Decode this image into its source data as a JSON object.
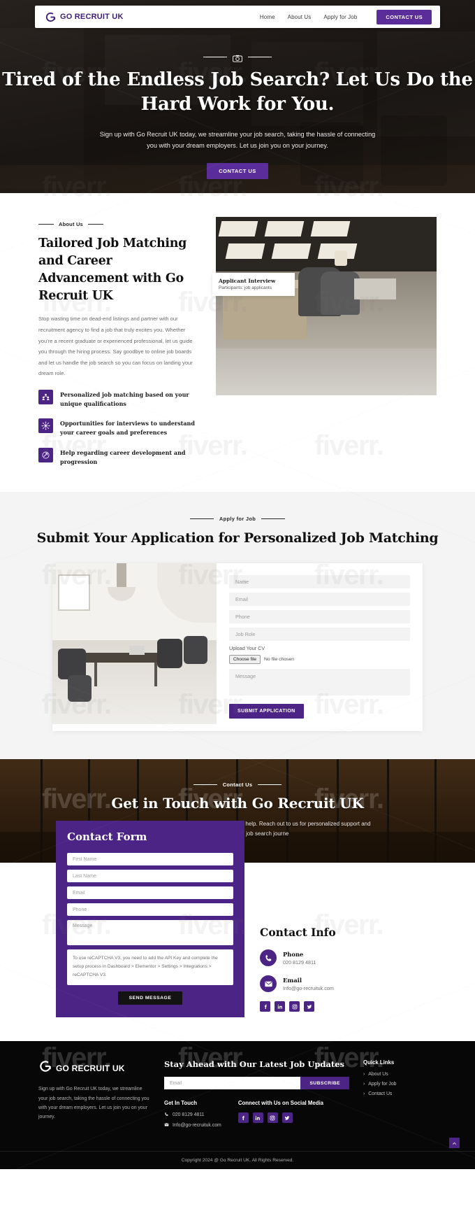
{
  "brand": {
    "name": "GO RECRUIT UK",
    "logo_icon": "g-circle-logo-icon"
  },
  "nav": {
    "links": [
      {
        "label": "Home"
      },
      {
        "label": "About Us"
      },
      {
        "label": "Apply for Job"
      }
    ],
    "cta": "CONTACT US"
  },
  "hero": {
    "eyebrow_icon": "camera-icon",
    "title": "Tired of the Endless Job Search? Let Us Do the Hard Work for You.",
    "subtitle": "Sign up with Go Recruit UK today, we streamline your job search, taking the hassle of connecting you with your dream employers. Let us join you on your journey.",
    "cta": "CONTACT US"
  },
  "about": {
    "eyebrow": "About Us",
    "heading": "Tailored Job Matching and Career Advancement with Go Recruit UK",
    "body": "Stop wasting time on dead-end listings and partner with our recruitment agency to find a job that truly excites you. Whether you're a recent graduate or experienced professional, let us guide you through the hiring process. Say goodbye to online job boards and let us handle the job search so you can focus on landing your dream role.",
    "features": [
      {
        "icon": "people-group-icon",
        "text": "Personalized job matching based on your unique qualifications"
      },
      {
        "icon": "network-nodes-icon",
        "text": "Opportunities for interviews to understand your career goals and preferences"
      },
      {
        "icon": "growth-arrow-icon",
        "text": "Help regarding career development and progression"
      }
    ],
    "photo_card": {
      "title": "Applicant Interview",
      "subtitle": "Participants: job applicants"
    }
  },
  "apply": {
    "eyebrow": "Apply for Job",
    "heading": "Submit Your Application for Personalized Job Matching",
    "form": {
      "name_placeholder": "Name",
      "email_placeholder": "Email",
      "phone_placeholder": "Phone",
      "job_role_placeholder": "Job Role",
      "upload_label": "Upload Your CV",
      "file_button": "Choose file",
      "file_status": "No file chosen",
      "message_placeholder": "Message",
      "submit": "SUBMIT APPLICATION"
    }
  },
  "contact": {
    "eyebrow": "Contact Us",
    "heading": "Get in Touch with Go Recruit UK",
    "subtitle": "Have questions or need assistance? Our team is here to help. Reach out to us for personalized support and expert guidance in your job search journe",
    "form": {
      "title": "Contact Form",
      "first_name_placeholder": "First Name",
      "last_name_placeholder": "Last Name",
      "email_placeholder": "Email",
      "phone_placeholder": "Phone",
      "message_placeholder": "Message",
      "recaptcha_notice": "To use reCAPTCHA V3, you need to add the API Key and complete the setup process in Dashboard > Elementor > Settings > Integrations > reCAPTCHA V3.",
      "send": "SEND MESSAGE"
    },
    "info": {
      "title": "Contact Info",
      "items": [
        {
          "icon": "phone-icon",
          "label": "Phone",
          "value": "020 8129 4811"
        },
        {
          "icon": "envelope-icon",
          "label": "Email",
          "value": "Info@go-recruituk.com"
        }
      ],
      "socials": [
        {
          "icon": "facebook-icon",
          "glyph": "f"
        },
        {
          "icon": "linkedin-icon",
          "glyph": "in"
        },
        {
          "icon": "instagram-icon",
          "glyph": "◎"
        },
        {
          "icon": "twitter-icon",
          "glyph": "▼"
        }
      ]
    }
  },
  "footer": {
    "brand": "GO RECRUIT UK",
    "about": "Sign up with Go Recruit UK today, we streamline your job search, taking the hassle of connecting you with your dream employers. Let us join you on your journey.",
    "newsletter": {
      "heading": "Stay Ahead with Our Latest Job Updates",
      "email_placeholder": "Email",
      "button": "SUBSCRIBE"
    },
    "get_in_touch": {
      "title": "Get In Touch",
      "phone": "020 8129 4811",
      "email": "Info@go-recruituk.com"
    },
    "social_block": {
      "title": "Connect with Us on Social Media",
      "socials": [
        {
          "icon": "facebook-icon",
          "glyph": "f"
        },
        {
          "icon": "linkedin-icon",
          "glyph": "in"
        },
        {
          "icon": "instagram-icon",
          "glyph": "◎"
        },
        {
          "icon": "twitter-icon",
          "glyph": "▼"
        }
      ]
    },
    "quick_links": {
      "title": "Quick Links",
      "items": [
        {
          "label": "About Us"
        },
        {
          "label": "Apply for Job"
        },
        {
          "label": "Contact Us"
        }
      ]
    },
    "copyright": "Copyright 2024 @ Go Recruit UK. All Rights Reserved.",
    "back_to_top_icon": "chevron-up-icon"
  },
  "colors": {
    "brand_purple": "#4c2486",
    "nav_purple": "#5b2d9b",
    "dark": "#070707"
  }
}
